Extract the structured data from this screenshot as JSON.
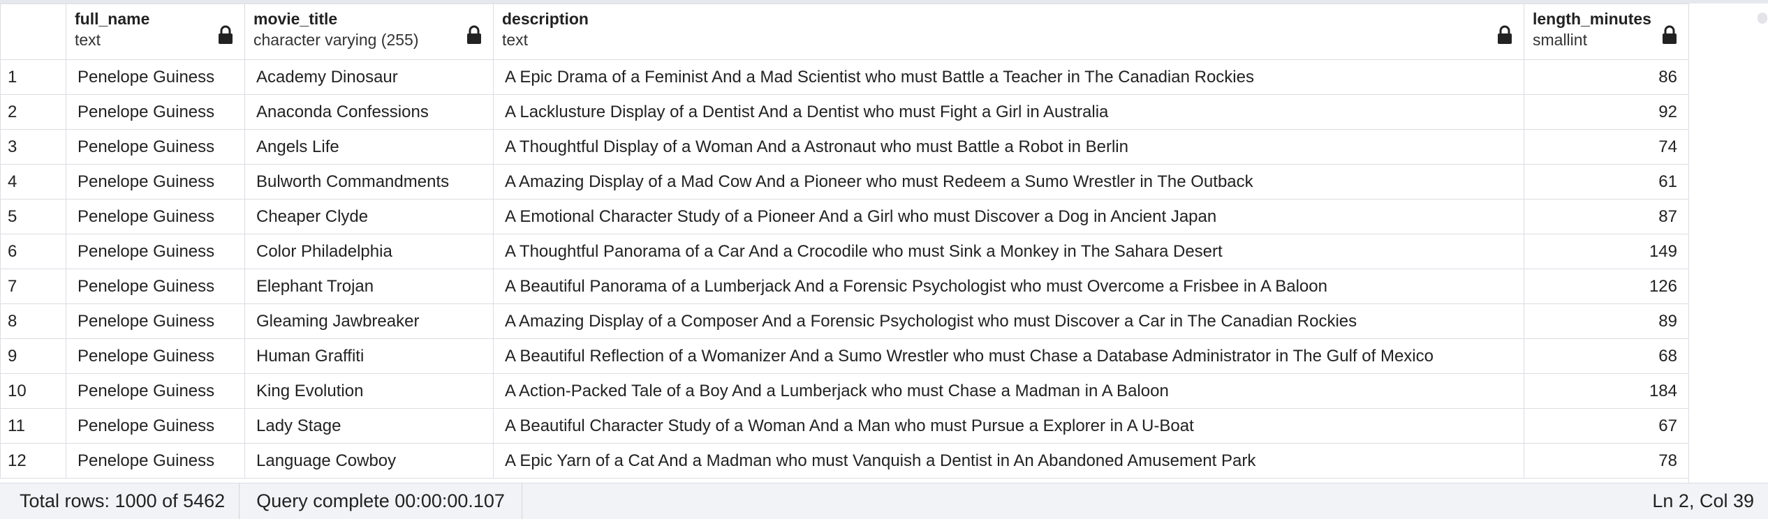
{
  "columns": [
    {
      "name": "full_name",
      "type": "text",
      "locked": true
    },
    {
      "name": "movie_title",
      "type": "character varying (255)",
      "locked": true
    },
    {
      "name": "description",
      "type": "text",
      "locked": true
    },
    {
      "name": "length_minutes",
      "type": "smallint",
      "locked": true
    }
  ],
  "rows": [
    {
      "n": "1",
      "full_name": "Penelope Guiness",
      "movie_title": "Academy Dinosaur",
      "description": "A Epic Drama of a Feminist And a Mad Scientist who must Battle a Teacher in The Canadian Rockies",
      "length_minutes": "86"
    },
    {
      "n": "2",
      "full_name": "Penelope Guiness",
      "movie_title": "Anaconda Confessions",
      "description": "A Lacklusture Display of a Dentist And a Dentist who must Fight a Girl in Australia",
      "length_minutes": "92"
    },
    {
      "n": "3",
      "full_name": "Penelope Guiness",
      "movie_title": "Angels Life",
      "description": "A Thoughtful Display of a Woman And a Astronaut who must Battle a Robot in Berlin",
      "length_minutes": "74"
    },
    {
      "n": "4",
      "full_name": "Penelope Guiness",
      "movie_title": "Bulworth Commandments",
      "description": "A Amazing Display of a Mad Cow And a Pioneer who must Redeem a Sumo Wrestler in The Outback",
      "length_minutes": "61"
    },
    {
      "n": "5",
      "full_name": "Penelope Guiness",
      "movie_title": "Cheaper Clyde",
      "description": "A Emotional Character Study of a Pioneer And a Girl who must Discover a Dog in Ancient Japan",
      "length_minutes": "87"
    },
    {
      "n": "6",
      "full_name": "Penelope Guiness",
      "movie_title": "Color Philadelphia",
      "description": "A Thoughtful Panorama of a Car And a Crocodile who must Sink a Monkey in The Sahara Desert",
      "length_minutes": "149"
    },
    {
      "n": "7",
      "full_name": "Penelope Guiness",
      "movie_title": "Elephant Trojan",
      "description": "A Beautiful Panorama of a Lumberjack And a Forensic Psychologist who must Overcome a Frisbee in A Baloon",
      "length_minutes": "126"
    },
    {
      "n": "8",
      "full_name": "Penelope Guiness",
      "movie_title": "Gleaming Jawbreaker",
      "description": "A Amazing Display of a Composer And a Forensic Psychologist who must Discover a Car in The Canadian Rockies",
      "length_minutes": "89"
    },
    {
      "n": "9",
      "full_name": "Penelope Guiness",
      "movie_title": "Human Graffiti",
      "description": "A Beautiful Reflection of a Womanizer And a Sumo Wrestler who must Chase a Database Administrator in The Gulf of Mexico",
      "length_minutes": "68"
    },
    {
      "n": "10",
      "full_name": "Penelope Guiness",
      "movie_title": "King Evolution",
      "description": "A Action-Packed Tale of a Boy And a Lumberjack who must Chase a Madman in A Baloon",
      "length_minutes": "184"
    },
    {
      "n": "11",
      "full_name": "Penelope Guiness",
      "movie_title": "Lady Stage",
      "description": "A Beautiful Character Study of a Woman And a Man who must Pursue a Explorer in A U-Boat",
      "length_minutes": "67"
    },
    {
      "n": "12",
      "full_name": "Penelope Guiness",
      "movie_title": "Language Cowboy",
      "description": "A Epic Yarn of a Cat And a Madman who must Vanquish a Dentist in An Abandoned Amusement Park",
      "length_minutes": "78"
    }
  ],
  "status": {
    "total_rows": "Total rows: 1000 of 5462",
    "query": "Query complete 00:00:00.107",
    "position": "Ln 2, Col 39"
  },
  "icons": {
    "lock": "lock-icon"
  },
  "colors": {
    "grid_border": "#dcdde3",
    "statusbar_bg": "#f2f3f6",
    "text": "#222222"
  }
}
